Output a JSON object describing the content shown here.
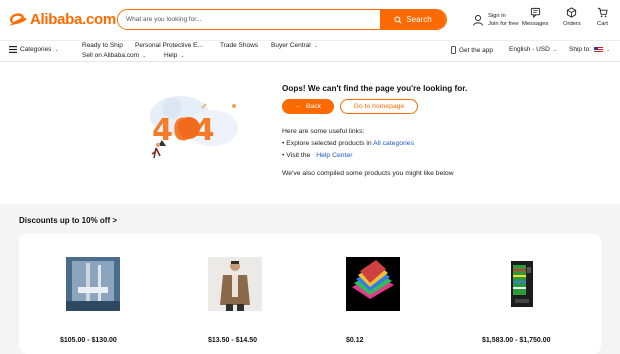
{
  "brand": {
    "name": "Alibaba.com",
    "color": "#ff6a00"
  },
  "search": {
    "placeholder": "What are you looking for...",
    "button": "Search"
  },
  "header": {
    "signin_line1": "Sign in",
    "signin_line2": "Join for free",
    "messages": "Messages",
    "orders": "Orders",
    "cart": "Cart"
  },
  "nav": {
    "categories": "Categories",
    "ready_to_ship": "Ready to Ship",
    "ppe": "Personal Protective E...",
    "trade_shows": "Trade Shows",
    "buyer_central": "Buyer Central",
    "sell_on": "Sell on Alibaba.com",
    "help": "Help",
    "get_app": "Get the app",
    "language": "English - USD",
    "ship_to": "Ship to:"
  },
  "error": {
    "title": "Oops! We can't find the page you're looking for.",
    "back": "Back",
    "home": "Go to homepage",
    "useful_intro": "Here are some useful links:",
    "explore_prefix": "• Explore selected products in",
    "all_categories": "All categories",
    "visit_prefix": "• Visit the",
    "help_center": "Help Center",
    "compiled": "We've also compiled some products you might like below"
  },
  "illustration": {
    "text": "404"
  },
  "discounts": {
    "title": "Discounts up to 10% off >",
    "products": [
      {
        "image": "shower-fixture",
        "price": "$105.00 - $130.00"
      },
      {
        "image": "man-jacket",
        "price": "$13.50 - $14.50"
      },
      {
        "image": "colored-folders",
        "price": "$0.12"
      },
      {
        "image": "vending-machine",
        "price": "$1,583.00 - $1,750.00"
      }
    ]
  }
}
